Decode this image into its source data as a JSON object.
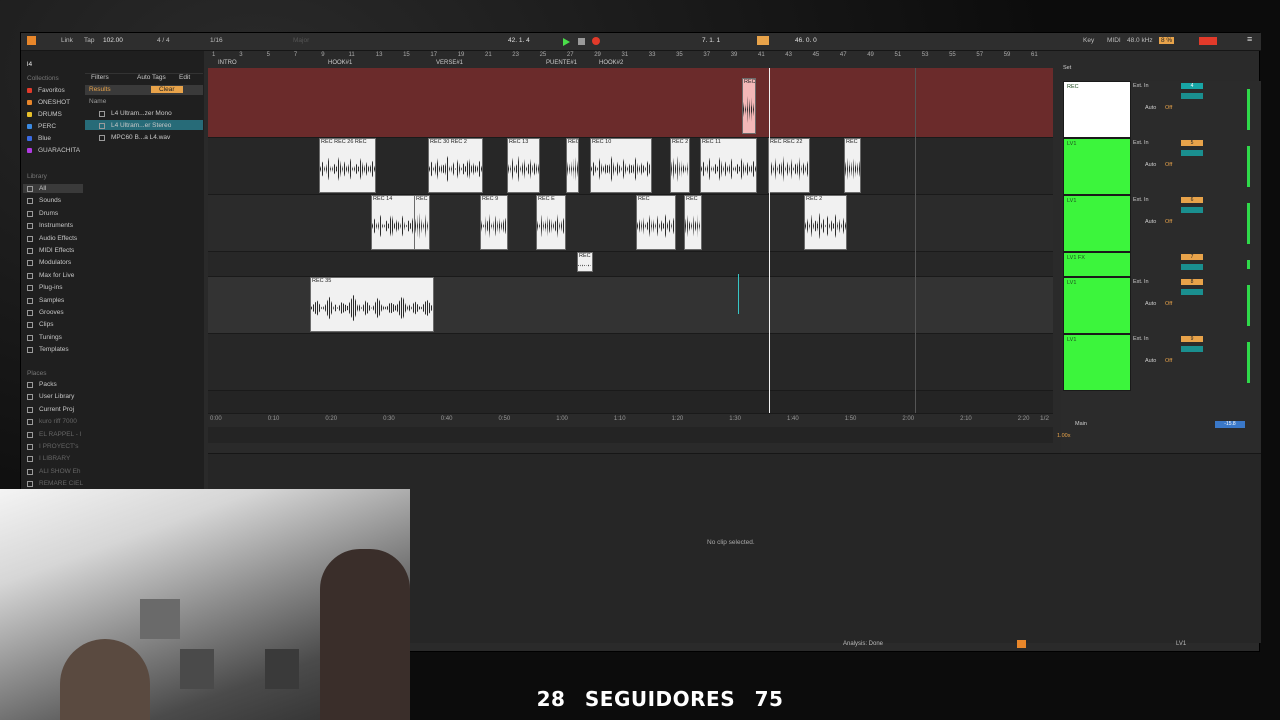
{
  "transport": {
    "link": "Link",
    "tap": "Tap",
    "tempo": "102.00",
    "signature": "4 / 4",
    "quantize": "1/16",
    "key_hint": "Major",
    "position": "42. 1. 4",
    "loop_start": "7. 1. 1",
    "loop_length": "46. 0. 0",
    "key_label": "Key",
    "midi_label": "MIDI",
    "sample_rate": "48.0 kHz",
    "cpu": "8 %"
  },
  "browser": {
    "search": "l4",
    "collections_header": "Collections",
    "collections": [
      {
        "label": "Favoritos",
        "color": "#e23a2a"
      },
      {
        "label": "ONESHOT",
        "color": "#e8862a"
      },
      {
        "label": "DRUMS",
        "color": "#e8c02a"
      },
      {
        "label": "PERC",
        "color": "#3a8ae2"
      },
      {
        "label": "Blue",
        "color": "#3a6ae2"
      },
      {
        "label": "GUARACHITA",
        "color": "#b03ae2"
      }
    ],
    "library_header": "Library",
    "library": [
      "All",
      "Sounds",
      "Drums",
      "Instruments",
      "Audio Effects",
      "MIDI Effects",
      "Modulators",
      "Max for Live",
      "Plug-ins",
      "Samples",
      "Grooves",
      "Clips",
      "Tunings",
      "Templates"
    ],
    "places_header": "Places",
    "places": [
      "Packs",
      "User Library",
      "Current Proj",
      "kuro riff 7000",
      "EL RAPPEL - I",
      "I PROYECT's",
      "I LIBRARY",
      "ALI SHOW Eh",
      "REMARE CIEL"
    ],
    "filters_label": "Filters",
    "autotags_label": "Auto Tags",
    "edit_label": "Edit",
    "results_label": "Results",
    "clear_label": "Clear",
    "name_header": "Name",
    "files": [
      "L4 Ultram...zer Mono",
      "L4 Ultram...er Stereo",
      "MPC60 B...a L4.wav"
    ]
  },
  "arrangement": {
    "bar_numbers": [
      "1",
      "3",
      "5",
      "7",
      "9",
      "11",
      "13",
      "15",
      "17",
      "19",
      "21",
      "23",
      "25",
      "27",
      "29",
      "31",
      "33",
      "35",
      "37",
      "39",
      "41",
      "43",
      "45",
      "47",
      "49",
      "51",
      "53",
      "55",
      "57",
      "59",
      "61"
    ],
    "markers": [
      "INTRO",
      "HOOK#1",
      "VERSE#1",
      "PUENTE#1",
      "HOOK#2"
    ],
    "time_ruler": [
      "0:00",
      "0:10",
      "0:20",
      "0:30",
      "0:40",
      "0:50",
      "1:00",
      "1:10",
      "1:20",
      "1:30",
      "1:40",
      "1:50",
      "2:00",
      "2:10",
      "2:20"
    ],
    "clips": [
      {
        "label": "REC 23",
        "lane": 0
      },
      {
        "label": "REC REC 26 REC",
        "lane": 1
      },
      {
        "label": "REC 30 REC 2",
        "lane": 1
      },
      {
        "label": "REC 13",
        "lane": 1
      },
      {
        "label": "REC",
        "lane": 1
      },
      {
        "label": "REC 10",
        "lane": 1
      },
      {
        "label": "REC 2",
        "lane": 1
      },
      {
        "label": "REC 11",
        "lane": 1
      },
      {
        "label": "REC REC 22",
        "lane": 1
      },
      {
        "label": "REC",
        "lane": 1
      },
      {
        "label": "REC 14",
        "lane": 2
      },
      {
        "label": "REC",
        "lane": 2
      },
      {
        "label": "REC 9",
        "lane": 2
      },
      {
        "label": "REC E",
        "lane": 2
      },
      {
        "label": "REC",
        "lane": 2
      },
      {
        "label": "REC",
        "lane": 2
      },
      {
        "label": "REC 2",
        "lane": 2
      },
      {
        "label": "REC",
        "lane": 3
      },
      {
        "label": "REC 35",
        "lane": 4
      }
    ],
    "page_indicator": "1/2",
    "main_label": "Main"
  },
  "mixer": {
    "set_label": "Set",
    "tracks": [
      {
        "name": "REC",
        "input": "Ext. In",
        "number": "4",
        "color": "#ffffff"
      },
      {
        "name": "LV1",
        "input": "Ext. In",
        "number": "5",
        "color": "#3cf53c"
      },
      {
        "name": "LV1",
        "input": "Ext. In",
        "number": "6",
        "color": "#3cf53c"
      },
      {
        "name": "LV1 FX",
        "input": "",
        "number": "7",
        "color": "#3cf53c"
      },
      {
        "name": "LV1",
        "input": "Ext. In",
        "number": "8",
        "color": "#3cf53c"
      },
      {
        "name": "LV1",
        "input": "Ext. In",
        "number": "9",
        "color": "#3cf53c"
      }
    ],
    "auto_label": "Auto",
    "off_label": "Off",
    "in_label": "In",
    "master_value": "-15.8",
    "zoom": "1.00x"
  },
  "detail": {
    "empty_message": "No clip selected.",
    "status": "Analysis: Done",
    "track_name": "LV1"
  },
  "overlay": {
    "left_num": "28",
    "label": "SEGUIDORES",
    "right_num": "75"
  }
}
